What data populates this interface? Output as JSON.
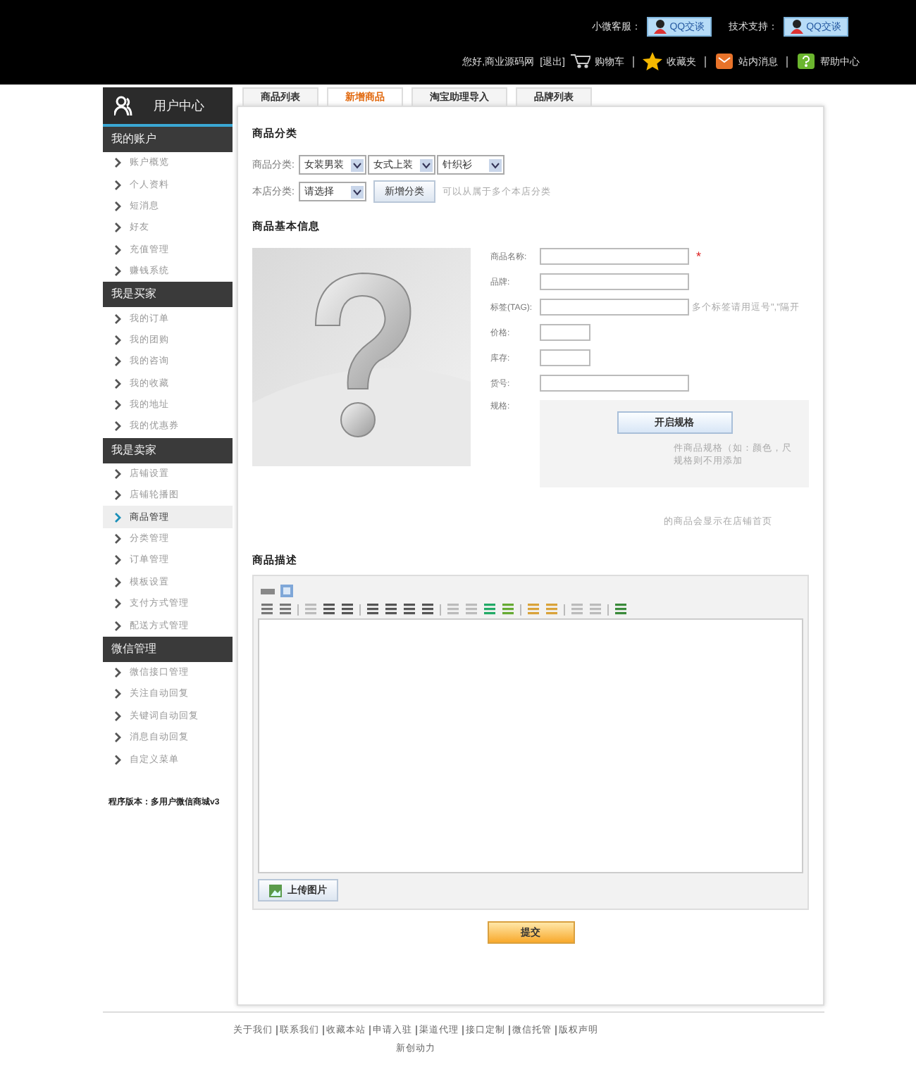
{
  "header": {
    "support": [
      {
        "label": "小微客服：",
        "button": "QQ交谈"
      },
      {
        "label": "技术支持：",
        "button": "QQ交谈"
      }
    ],
    "greeting": "您好,商业源码网",
    "logout": "[退出]",
    "links": [
      {
        "kind": "cart",
        "label": "购物车"
      },
      {
        "kind": "star",
        "label": "收藏夹"
      },
      {
        "kind": "mail",
        "label": "站内消息"
      },
      {
        "kind": "help",
        "label": "帮助中心"
      }
    ]
  },
  "sidebar": {
    "title": "用户中心",
    "groups": [
      {
        "title": "我的账户",
        "items": [
          {
            "label": "账户概览",
            "selected": false
          },
          {
            "label": "个人资料",
            "selected": false
          },
          {
            "label": "短消息",
            "selected": false
          },
          {
            "label": "好友",
            "selected": false
          },
          {
            "label": "充值管理",
            "selected": false
          },
          {
            "label": "赚钱系统",
            "selected": false
          }
        ]
      },
      {
        "title": "我是买家",
        "items": [
          {
            "label": "我的订单",
            "selected": false
          },
          {
            "label": "我的团购",
            "selected": false
          },
          {
            "label": "我的咨询",
            "selected": false
          },
          {
            "label": "我的收藏",
            "selected": false
          },
          {
            "label": "我的地址",
            "selected": false
          },
          {
            "label": "我的优惠券",
            "selected": false
          }
        ]
      },
      {
        "title": "我是卖家",
        "items": [
          {
            "label": "店铺设置",
            "selected": false
          },
          {
            "label": "店铺轮播图",
            "selected": false
          },
          {
            "label": "商品管理",
            "selected": true
          },
          {
            "label": "分类管理",
            "selected": false
          },
          {
            "label": "订单管理",
            "selected": false
          },
          {
            "label": "模板设置",
            "selected": false
          },
          {
            "label": "支付方式管理",
            "selected": false
          },
          {
            "label": "配送方式管理",
            "selected": false
          }
        ]
      },
      {
        "title": "微信管理",
        "items": [
          {
            "label": "微信接口管理",
            "selected": false
          },
          {
            "label": "关注自动回复",
            "selected": false
          },
          {
            "label": "关键词自动回复",
            "selected": false
          },
          {
            "label": "消息自动回复",
            "selected": false
          },
          {
            "label": "自定义菜单",
            "selected": false
          }
        ]
      }
    ],
    "version": "程序版本：多用户微信商城v3"
  },
  "tabs": [
    {
      "label": "商品列表",
      "selected": false
    },
    {
      "label": "新增商品",
      "selected": true
    },
    {
      "label": "淘宝助理导入",
      "selected": false
    },
    {
      "label": "品牌列表",
      "selected": false
    }
  ],
  "category": {
    "title": "商品分类",
    "goods_label": "商品分类:",
    "goods_selects": [
      "女装男装",
      "女式上装",
      "针织衫"
    ],
    "shop_label": "本店分类:",
    "shop_select": "请选择",
    "add_button": "新增分类",
    "hint": "可以从属于多个本店分类"
  },
  "basic": {
    "title": "商品基本信息",
    "fields": [
      {
        "label": "商品名称:",
        "kind": "long",
        "required_mark": "*"
      },
      {
        "label": "品牌:",
        "kind": "long"
      },
      {
        "label": "标签(TAG):",
        "kind": "long",
        "hint": "多个标签请用逗号\",\"隔开"
      },
      {
        "label": "价格:",
        "kind": "short"
      },
      {
        "label": "库存:",
        "kind": "short"
      },
      {
        "label": "货号:",
        "kind": "long"
      }
    ],
    "spec": {
      "label": "规格:",
      "button": "开启规格",
      "notes": [
        "件商品规格（如：颜色，尺",
        "规格则不用添加"
      ]
    },
    "recommend_hint": "的商品会显示在店铺首页"
  },
  "description": {
    "title": "商品描述",
    "upload": "上传图片"
  },
  "submit": "提交",
  "footer": {
    "links": [
      "关于我们",
      "联系我们",
      "收藏本站",
      "申请入驻",
      "渠道代理",
      "接口定制",
      "微信托管",
      "版权声明"
    ],
    "credit": "新创动力"
  }
}
